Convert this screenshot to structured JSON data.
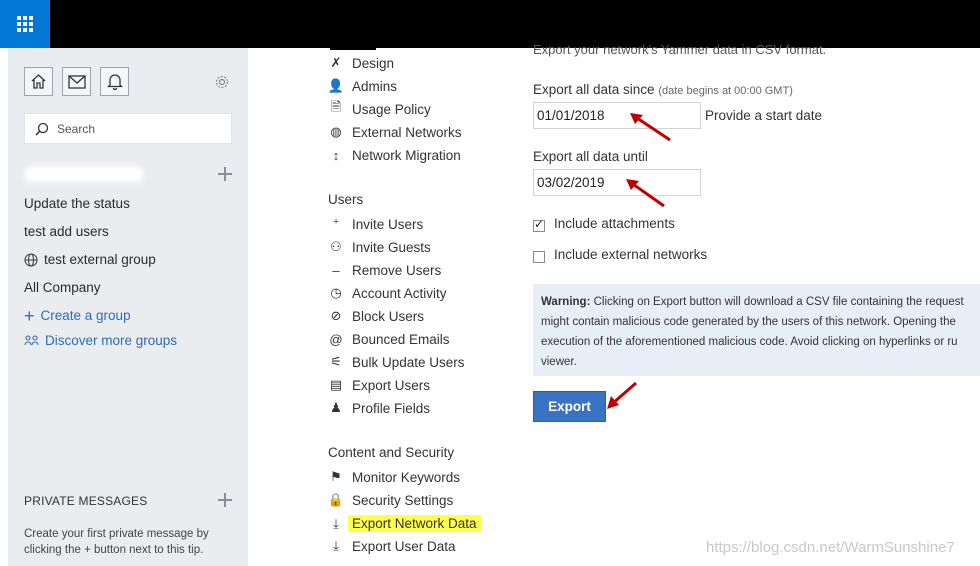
{
  "topbar": {
    "app_launcher_icon": "waffle-grid-icon",
    "brand_color": "#0078d4"
  },
  "sidebar": {
    "icons": [
      "home-icon",
      "mail-icon",
      "bell-icon",
      "gear-icon"
    ],
    "search_placeholder": "Search",
    "items": [
      {
        "label": "Update the status"
      },
      {
        "label": "test add users"
      },
      {
        "label": "test external group",
        "icon": "globe-icon"
      },
      {
        "label": "All Company"
      }
    ],
    "create_group": "Create a group",
    "discover_groups": "Discover more groups",
    "private_messages_title": "PRIVATE MESSAGES",
    "private_messages_tip": "Create your first private message by clicking the + button next to this tip."
  },
  "nav": {
    "network_items": [
      {
        "label": "Design",
        "icon": "design-tools-icon"
      },
      {
        "label": "Admins",
        "icon": "admin-user-icon"
      },
      {
        "label": "Usage Policy",
        "icon": "policy-icon"
      },
      {
        "label": "External Networks",
        "icon": "globe-icon"
      },
      {
        "label": "Network Migration",
        "icon": "migration-arrows-icon"
      }
    ],
    "users_heading": "Users",
    "users_items": [
      {
        "label": "Invite Users",
        "icon": "invite-user-icon"
      },
      {
        "label": "Invite Guests",
        "icon": "invite-guest-icon"
      },
      {
        "label": "Remove Users",
        "icon": "remove-user-icon"
      },
      {
        "label": "Account Activity",
        "icon": "clock-icon"
      },
      {
        "label": "Block Users",
        "icon": "block-user-icon"
      },
      {
        "label": "Bounced Emails",
        "icon": "at-sign-icon"
      },
      {
        "label": "Bulk Update Users",
        "icon": "bulk-update-icon"
      },
      {
        "label": "Export Users",
        "icon": "export-users-icon"
      },
      {
        "label": "Profile Fields",
        "icon": "profile-icon"
      }
    ],
    "content_heading": "Content and Security",
    "content_items": [
      {
        "label": "Monitor Keywords",
        "icon": "flag-icon"
      },
      {
        "label": "Security Settings",
        "icon": "lock-icon"
      },
      {
        "label": "Export Network Data",
        "icon": "download-icon",
        "active": true
      },
      {
        "label": "Export User Data",
        "icon": "download-icon"
      }
    ]
  },
  "form": {
    "description": "Export your network's Yammer data in CSV format.",
    "since_label": "Export all data since",
    "since_hint": "(date begins at 00:00 GMT)",
    "since_value": "01/01/2018",
    "since_note": "Provide a start date",
    "until_label": "Export all data until",
    "until_value": "03/02/2019",
    "include_attachments": {
      "label": "Include attachments",
      "checked": true
    },
    "include_external": {
      "label": "Include external networks",
      "checked": false
    },
    "warning_title": "Warning:",
    "warning_lines": [
      "Clicking on Export button will download a CSV file containing the request",
      "might contain malicious code generated by the users of this network. Opening the",
      "execution of the aforementioned malicious code. Avoid clicking on hyperlinks or ru",
      "viewer."
    ],
    "export_button": "Export",
    "accent_color": "#3b73c4",
    "annotation_arrow_color": "#c00000"
  },
  "watermark": "https://blog.csdn.net/WarmSunshine7"
}
